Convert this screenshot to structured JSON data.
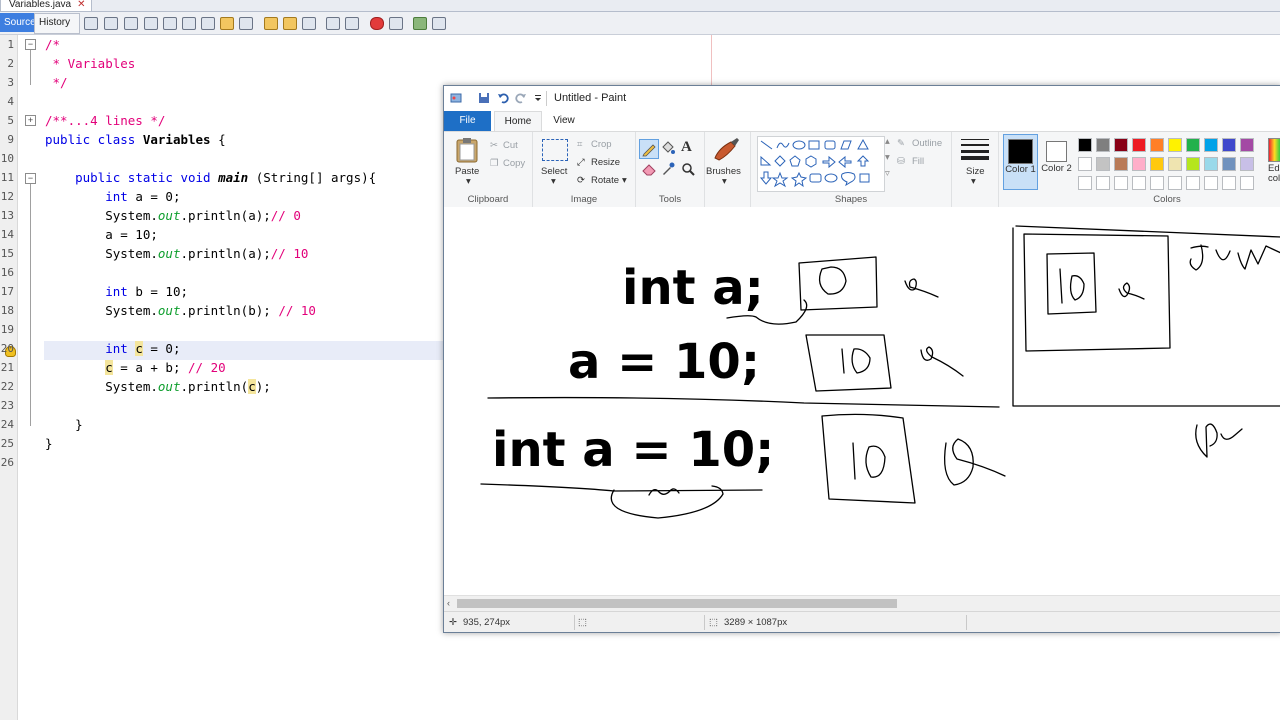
{
  "ide": {
    "file_tab": "Variables.java",
    "tabs": {
      "source": "Source",
      "history": "History"
    },
    "lines": [
      {
        "n": "1",
        "segs": [
          [
            "cm",
            "/*"
          ]
        ]
      },
      {
        "n": "2",
        "segs": [
          [
            "cm",
            " * Variables"
          ]
        ]
      },
      {
        "n": "3",
        "segs": [
          [
            "cm",
            " */"
          ]
        ]
      },
      {
        "n": "4",
        "segs": []
      },
      {
        "n": "5",
        "segs": [
          [
            "cm",
            "/**...4 lines */"
          ]
        ]
      },
      {
        "n": "9",
        "segs": [
          [
            "kw",
            "public class "
          ],
          [
            "bold",
            "Variables"
          ],
          [
            "",
            " {"
          ]
        ]
      },
      {
        "n": "10",
        "segs": []
      },
      {
        "n": "11",
        "segs": [
          [
            "",
            "    "
          ],
          [
            "kw",
            "public static void "
          ],
          [
            "boldit",
            "main"
          ],
          [
            "",
            " (String[] args){"
          ]
        ]
      },
      {
        "n": "12",
        "segs": [
          [
            "",
            "        "
          ],
          [
            "kw",
            "int"
          ],
          [
            "",
            " a = 0;"
          ]
        ]
      },
      {
        "n": "13",
        "segs": [
          [
            "",
            "        System."
          ],
          [
            "st",
            "out"
          ],
          [
            "",
            ".println(a);"
          ],
          [
            "cm",
            "// 0"
          ]
        ]
      },
      {
        "n": "14",
        "segs": [
          [
            "",
            "        a = 10;"
          ]
        ]
      },
      {
        "n": "15",
        "segs": [
          [
            "",
            "        System."
          ],
          [
            "st",
            "out"
          ],
          [
            "",
            ".println(a);"
          ],
          [
            "cm",
            "// 10"
          ]
        ]
      },
      {
        "n": "16",
        "segs": []
      },
      {
        "n": "17",
        "segs": [
          [
            "",
            "        "
          ],
          [
            "kw",
            "int"
          ],
          [
            "",
            " b = 10;"
          ]
        ]
      },
      {
        "n": "18",
        "segs": [
          [
            "",
            "        System."
          ],
          [
            "st",
            "out"
          ],
          [
            "",
            ".println(b); "
          ],
          [
            "cm",
            "// 10"
          ]
        ]
      },
      {
        "n": "19",
        "segs": []
      },
      {
        "n": "20",
        "segs": [
          [
            "",
            "        "
          ],
          [
            "kw",
            "int "
          ],
          [
            "hl",
            "c"
          ],
          [
            "",
            " = 0;"
          ]
        ]
      },
      {
        "n": "21",
        "segs": [
          [
            "",
            "        "
          ],
          [
            "hl",
            "c"
          ],
          [
            "",
            " = a + b; "
          ],
          [
            "cm",
            "// 20"
          ]
        ]
      },
      {
        "n": "22",
        "segs": [
          [
            "",
            "        System."
          ],
          [
            "st",
            "out"
          ],
          [
            "",
            ".println("
          ],
          [
            "hl",
            "c"
          ],
          [
            "",
            ");"
          ]
        ]
      },
      {
        "n": "23",
        "segs": []
      },
      {
        "n": "24",
        "segs": [
          [
            "",
            "    }"
          ]
        ]
      },
      {
        "n": "25",
        "segs": [
          [
            "",
            "}"
          ]
        ]
      },
      {
        "n": "26",
        "segs": []
      }
    ]
  },
  "paint": {
    "title": "Untitled - Paint",
    "tabs": {
      "file": "File",
      "home": "Home",
      "view": "View"
    },
    "clipboard": {
      "paste": "Paste",
      "cut": "Cut",
      "copy": "Copy",
      "label": "Clipboard"
    },
    "image": {
      "select": "Select",
      "crop": "Crop",
      "resize": "Resize",
      "rotate": "Rotate",
      "label": "Image"
    },
    "tools": {
      "label": "Tools"
    },
    "brushes": "Brushes",
    "shapes": {
      "outline": "Outline",
      "fill": "Fill",
      "label": "Shapes"
    },
    "size": "Size",
    "color1": "Color 1",
    "color2": "Color 2",
    "colors_label": "Colors",
    "edit_colors": "Edit colors",
    "palette_row1": [
      "#000000",
      "#7f7f7f",
      "#880015",
      "#ed1c24",
      "#ff7f27",
      "#fff200",
      "#22b14c",
      "#00a2e8",
      "#3f48cc",
      "#a349a4"
    ],
    "palette_row2": [
      "#ffffff",
      "#c3c3c3",
      "#b97a57",
      "#ffaec9",
      "#ffc90e",
      "#efe4b0",
      "#b5e61d",
      "#99d9ea",
      "#7092be",
      "#c8bfe7"
    ],
    "status": {
      "cursor": "935, 274px",
      "canvas_size": "3289 × 1087px"
    },
    "canvas_text": [
      "int a;",
      "a = 10;",
      "int a = 10;"
    ],
    "drawn_label_jvm": "JVM"
  }
}
